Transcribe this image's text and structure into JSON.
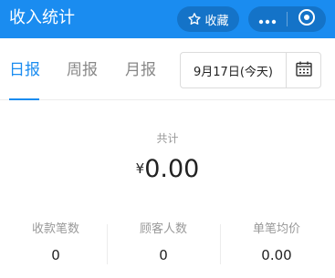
{
  "header": {
    "title": "收入统计",
    "favorite_label": "收藏",
    "favorite_icon": "star-outline-icon",
    "more_icon": "more-dots-icon",
    "close_icon": "mini-program-close-icon",
    "background_color": "#1a8cf0"
  },
  "tabs": [
    {
      "label": "日报",
      "active": true
    },
    {
      "label": "周报",
      "active": false
    },
    {
      "label": "月报",
      "active": false
    }
  ],
  "date_picker": {
    "value": "9月17日(今天)",
    "icon": "calendar-icon"
  },
  "summary": {
    "label": "共计",
    "currency": "¥",
    "amount": "0.00"
  },
  "stats": [
    {
      "label": "收款笔数",
      "value": "0"
    },
    {
      "label": "顾客人数",
      "value": "0"
    },
    {
      "label": "单笔均价",
      "value": "0.00"
    }
  ],
  "colors": {
    "accent": "#1a8cf0",
    "muted_text": "#999999"
  }
}
